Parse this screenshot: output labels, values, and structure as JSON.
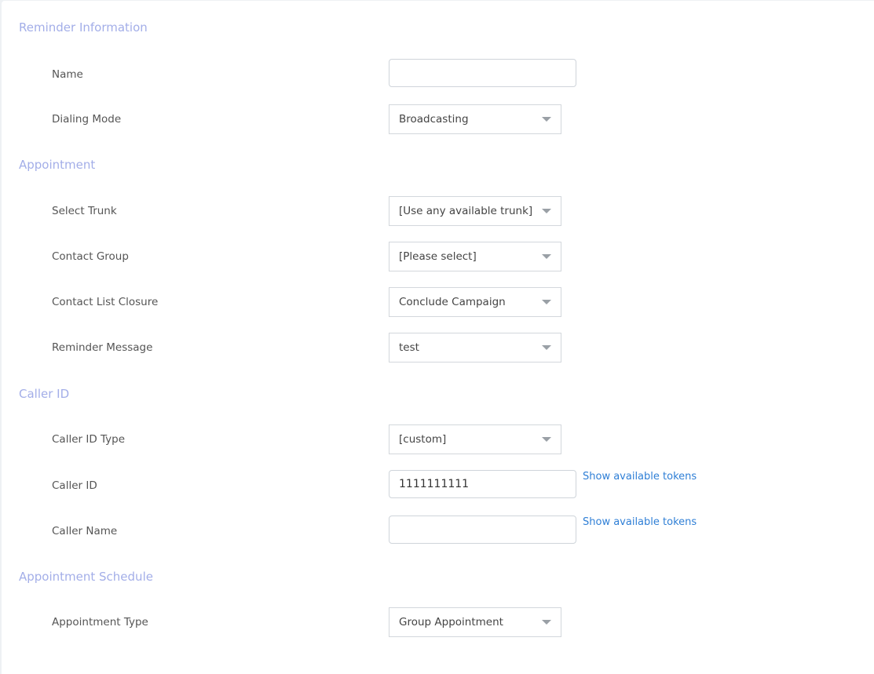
{
  "sections": {
    "reminder_information": {
      "title": "Reminder Information",
      "name_label": "Name",
      "name_value": "",
      "dialing_mode_label": "Dialing Mode",
      "dialing_mode_value": "Broadcasting"
    },
    "appointment": {
      "title": "Appointment",
      "select_trunk_label": "Select Trunk",
      "select_trunk_value": "[Use any available trunk]",
      "contact_group_label": "Contact Group",
      "contact_group_value": "[Please select]",
      "contact_list_closure_label": "Contact List Closure",
      "contact_list_closure_value": "Conclude Campaign",
      "reminder_message_label": "Reminder Message",
      "reminder_message_value": "test"
    },
    "caller_id": {
      "title": "Caller ID",
      "caller_id_type_label": "Caller ID Type",
      "caller_id_type_value": "[custom]",
      "caller_id_label": "Caller ID",
      "caller_id_value": "1111111111",
      "caller_name_label": "Caller Name",
      "caller_name_value": "",
      "tokens_link": "Show available tokens"
    },
    "appointment_schedule": {
      "title": "Appointment Schedule",
      "appointment_type_label": "Appointment Type",
      "appointment_type_value": "Group Appointment"
    }
  }
}
